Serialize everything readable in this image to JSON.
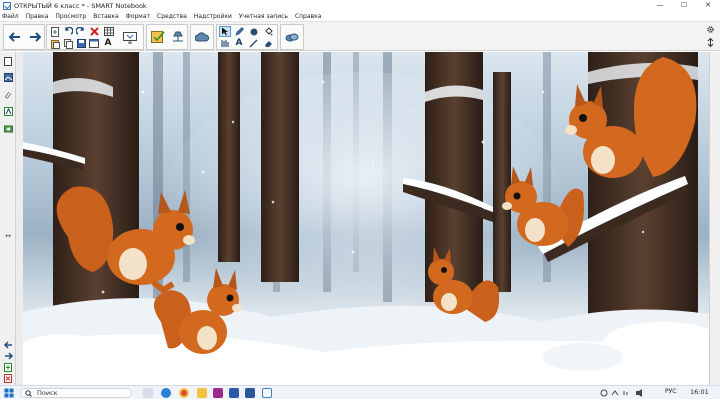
{
  "window": {
    "title": "ОТКРЫТЫЙ 6 класс * - SMART Notebook",
    "minimize_glyph": "—",
    "maximize_glyph": "☐",
    "close_glyph": "✕"
  },
  "menu": {
    "items": [
      "Файл",
      "Правка",
      "Просмотр",
      "Вставка",
      "Формат",
      "Средства",
      "Надстройки",
      "Учетная запись",
      "Справка"
    ]
  },
  "toolbar": {
    "icons": [
      "back-arrow",
      "forward-arrow",
      "undo",
      "redo",
      "delete",
      "table",
      "add-page",
      "save",
      "paste",
      "full-screen",
      "screen-shade",
      "display",
      "properties",
      "smart-document-camera",
      "select",
      "pen",
      "eraser",
      "shapes",
      "lines",
      "text",
      "fill",
      "magic-pen",
      "addons"
    ],
    "text_tool_glyph": "A"
  },
  "sidebar": {
    "icons": [
      "page-sorter",
      "gallery",
      "attachments",
      "properties",
      "addons"
    ],
    "resize_glyph": "↔"
  },
  "canvas": {
    "image_alt": "winter forest with squirrels",
    "accent_colors": {
      "fur": "#d2691e",
      "fur_light": "#f3e2c7",
      "trunk": "#4a3426",
      "snow": "#ffffff",
      "sky": "#b5c8d8"
    }
  },
  "taskbar": {
    "search_placeholder": "Поиск",
    "lang": "РУС",
    "time": "16:01",
    "apps": [
      "task-view",
      "edge",
      "chrome",
      "file-explorer",
      "notebook",
      "fx-app",
      "word",
      "smart-notebook"
    ]
  }
}
